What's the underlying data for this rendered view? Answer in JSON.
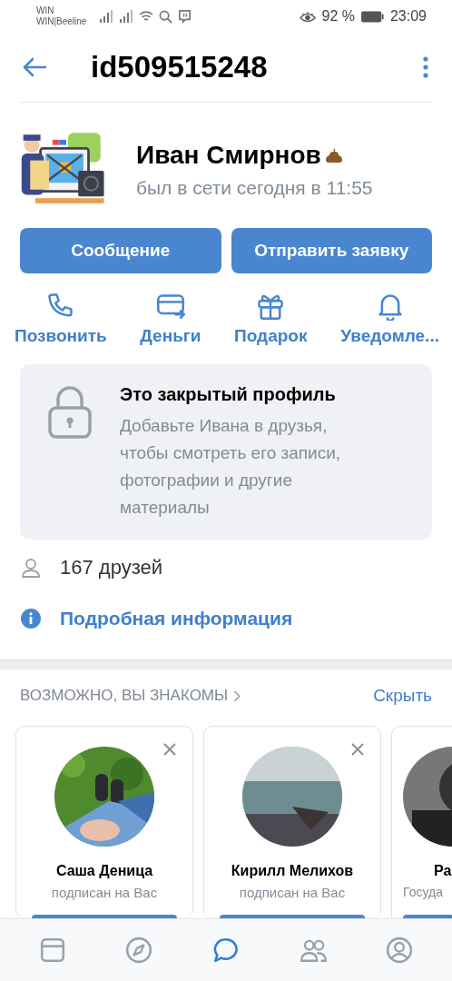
{
  "status_bar": {
    "carrier_top": "WIN",
    "carrier_bottom": "WIN|Beeline",
    "battery": "92 %",
    "time": "23:09"
  },
  "header": {
    "title": "id509515248"
  },
  "profile": {
    "name": "Иван Смирнов",
    "last_seen": "был в сети сегодня в 11:55"
  },
  "buttons": [
    {
      "label": "Сообщение"
    },
    {
      "label": "Отправить заявку"
    }
  ],
  "actions": [
    {
      "kind": "call",
      "label": "Позвонить"
    },
    {
      "kind": "money",
      "label": "Деньги"
    },
    {
      "kind": "gift",
      "label": "Подарок"
    },
    {
      "kind": "notify",
      "label": "Уведомле..."
    }
  ],
  "closed_notice": {
    "title": "Это закрытый профиль",
    "text": "Добавьте Ивана в друзья, чтобы смотреть его записи, фотографии и другие материалы"
  },
  "friends": {
    "label": "167 друзей"
  },
  "details_link": {
    "label": "Подробная информация"
  },
  "suggestions": {
    "title": "ВОЗМОЖНО, ВЫ ЗНАКОМЫ",
    "hide": "Скрыть",
    "cards": [
      {
        "kind": "full",
        "name": "Саша Деница",
        "subtitle": "подписан на Вас"
      },
      {
        "kind": "full",
        "name": "Кирилл Мелихов",
        "subtitle": "подписан на Вас"
      },
      {
        "kind": "partial",
        "name": "Ра",
        "subtitle": "Госуда"
      }
    ]
  },
  "nav": [
    {
      "kind": "feed",
      "selected": false
    },
    {
      "kind": "explore",
      "selected": false
    },
    {
      "kind": "messages",
      "selected": true
    },
    {
      "kind": "friends",
      "selected": false
    },
    {
      "kind": "profile",
      "selected": false
    }
  ]
}
